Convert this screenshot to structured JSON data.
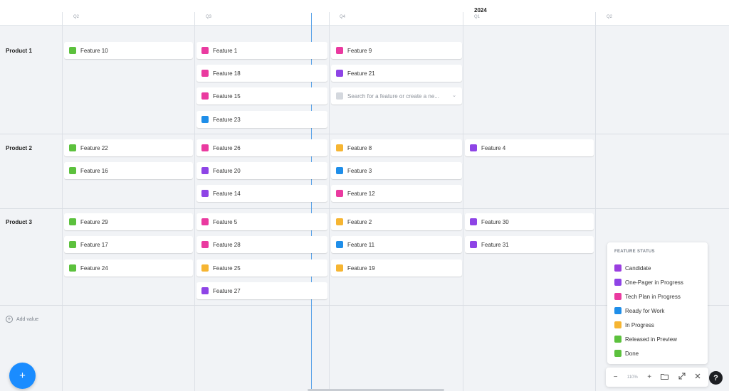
{
  "header": {
    "year": "2024",
    "quarters": [
      "Q2",
      "Q3",
      "Q4",
      "Q1",
      "Q2"
    ]
  },
  "rows": [
    {
      "label": "Product 1"
    },
    {
      "label": "Product 2"
    },
    {
      "label": "Product 3"
    }
  ],
  "cards": {
    "p1q1a": "Feature 10",
    "p1q2a": "Feature 1",
    "p1q2b": "Feature 18",
    "p1q2c": "Feature 15",
    "p1q2d": "Feature 23",
    "p1q3a": "Feature 9",
    "p1q3b": "Feature 21",
    "p2q1a": "Feature 22",
    "p2q1b": "Feature 16",
    "p2q2a": "Feature 26",
    "p2q2b": "Feature 20",
    "p2q2c": "Feature 14",
    "p2q3a": "Feature 8",
    "p2q3b": "Feature 3",
    "p2q3c": "Feature 12",
    "p2q4a": "Feature 4",
    "p3q1a": "Feature 29",
    "p3q1b": "Feature 17",
    "p3q1c": "Feature 24",
    "p3q2a": "Feature 5",
    "p3q2b": "Feature 28",
    "p3q2c": "Feature 25",
    "p3q2d": "Feature 27",
    "p3q3a": "Feature 2",
    "p3q3b": "Feature 11",
    "p3q3c": "Feature 19",
    "p3q4a": "Feature 30",
    "p3q4b": "Feature 31"
  },
  "search": {
    "placeholder": "Search for a feature or create a ne..."
  },
  "add_value": "Add value",
  "legend": {
    "title": "FEATURE STATUS",
    "items": [
      "Candidate",
      "One-Pager in Progress",
      "Tech Plan in Progress",
      "Ready for Work",
      "In Progress",
      "Released in Preview",
      "Done"
    ]
  },
  "status_colors": {
    "candidate": "#9b3fe0",
    "one_pager": "#8e44e6",
    "tech_plan": "#ea3aa0",
    "ready": "#1f8ee9",
    "in_progress": "#f6b532",
    "released": "#5cc13d",
    "done": "#5cc13d"
  },
  "zoom": {
    "level": "110%",
    "minus": "−",
    "plus": "+"
  },
  "fab": "+",
  "help": "?"
}
